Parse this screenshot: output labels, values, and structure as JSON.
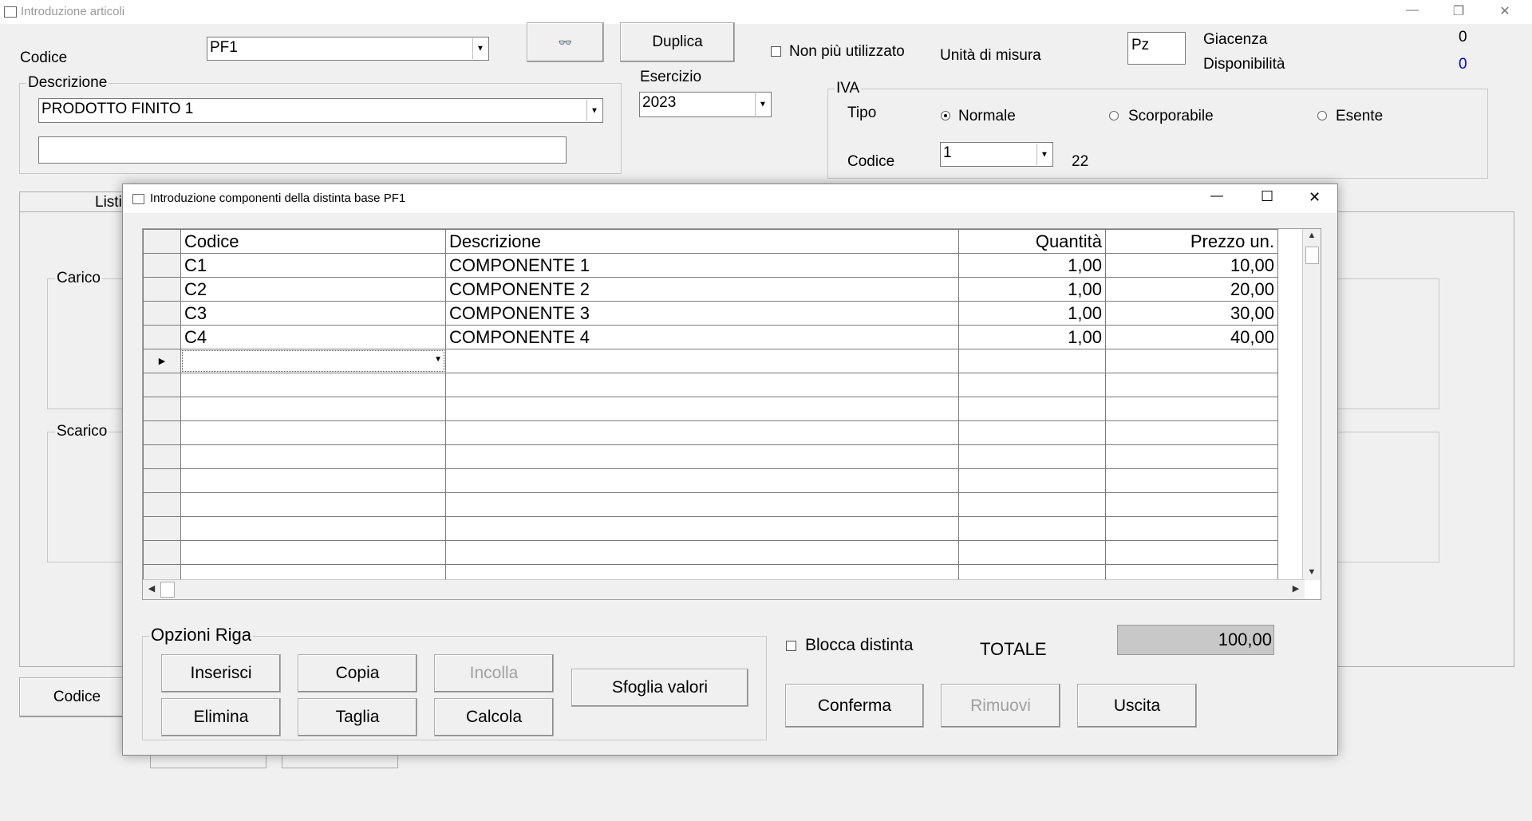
{
  "window": {
    "title": "Introduzione articoli",
    "controls": {
      "minimize": "—",
      "restore": "❐",
      "close": "✕"
    }
  },
  "form": {
    "codice_label": "Codice",
    "codice_value": "PF1",
    "search_button_icon": "binoculars-icon",
    "search_button_glyph": "👓",
    "duplica_label": "Duplica",
    "non_piu_label": "Non più utilizzato",
    "unita_label": "Unità di misura",
    "unita_value": "Pz",
    "giacenza_label": "Giacenza",
    "giacenza_value": "0",
    "disponibilita_label": "Disponibilità",
    "disponibilita_value": "0",
    "descrizione_legend": "Descrizione",
    "descrizione_value": "PRODOTTO FINITO 1",
    "descrizione2_value": "",
    "esercizio_label": "Esercizio",
    "esercizio_value": "2023",
    "iva": {
      "legend": "IVA",
      "tipo_label": "Tipo",
      "options": [
        "Normale",
        "Scorporabile",
        "Esente"
      ],
      "selected": "Normale",
      "codice_label": "Codice",
      "codice_value": "1",
      "aliquota": "22"
    },
    "tab_partial_label": "Listi",
    "carico_legend": "Carico",
    "scarico_legend": "Scarico",
    "bottom_codice_label": "Codice"
  },
  "dialog": {
    "title": "Introduzione componenti della distinta base PF1",
    "controls": {
      "minimize": "—",
      "maximize": "☐",
      "close": "✕"
    },
    "columns": [
      "Codice",
      "Descrizione",
      "Quantità",
      "Prezzo un."
    ],
    "rows": [
      {
        "codice": "C1",
        "descrizione": "COMPONENTE 1",
        "quantita": "1,00",
        "prezzo": "10,00"
      },
      {
        "codice": "C2",
        "descrizione": "COMPONENTE 2",
        "quantita": "1,00",
        "prezzo": "20,00"
      },
      {
        "codice": "C3",
        "descrizione": "COMPONENTE 3",
        "quantita": "1,00",
        "prezzo": "30,00"
      },
      {
        "codice": "C4",
        "descrizione": "COMPONENTE 4",
        "quantita": "1,00",
        "prezzo": "40,00"
      }
    ],
    "current_row_marker": "▶",
    "opzioni_riga": {
      "legend": "Opzioni Riga",
      "inserisci": "Inserisci",
      "copia": "Copia",
      "incolla": "Incolla",
      "elimina": "Elimina",
      "taglia": "Taglia",
      "calcola": "Calcola"
    },
    "sfoglia_label": "Sfoglia valori",
    "blocca_label": "Blocca distinta",
    "totale_label": "TOTALE",
    "totale_value": "100,00",
    "conferma_label": "Conferma",
    "rimuovi_label": "Rimuovi",
    "uscita_label": "Uscita"
  }
}
